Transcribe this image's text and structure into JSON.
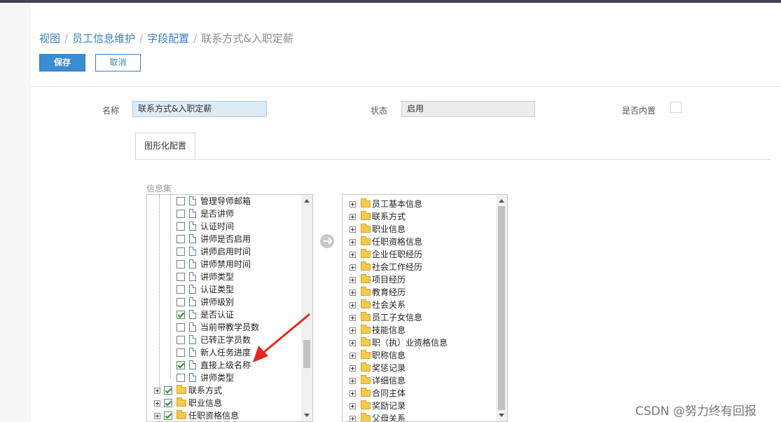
{
  "breadcrumb": [
    "视图",
    "员工信息维护",
    "字段配置",
    "联系方式&入职定薪"
  ],
  "toolbar": {
    "save_label": "保存",
    "cancel_label": "取消"
  },
  "form": {
    "name_label": "名称",
    "name_value": "联系方式&入职定薪",
    "status_label": "状态",
    "status_value": "启用",
    "builtin_label": "是否内置",
    "builtin_checked": false
  },
  "tab": {
    "label": "图形化配置"
  },
  "info_set_label": "信息集",
  "left_tree": {
    "child_items": [
      {
        "label": "管理导师邮箱",
        "checked": false
      },
      {
        "label": "是否讲师",
        "checked": false
      },
      {
        "label": "认证时间",
        "checked": false
      },
      {
        "label": "讲师是否启用",
        "checked": false
      },
      {
        "label": "讲师启用时间",
        "checked": false
      },
      {
        "label": "讲师禁用时间",
        "checked": false
      },
      {
        "label": "讲师类型",
        "checked": false
      },
      {
        "label": "认证类型",
        "checked": false
      },
      {
        "label": "讲师级别",
        "checked": false
      },
      {
        "label": "是否认证",
        "checked": true
      },
      {
        "label": "当前带教学员数",
        "checked": false
      },
      {
        "label": "已转正学员数",
        "checked": false
      },
      {
        "label": "新人任务进度",
        "checked": false
      },
      {
        "label": "直接上级名称",
        "checked": true
      },
      {
        "label": "讲师类型",
        "checked": false
      }
    ],
    "group_items": [
      {
        "label": "联系方式",
        "checked": true
      },
      {
        "label": "职业信息",
        "checked": true
      },
      {
        "label": "任职资格信息",
        "checked": true
      }
    ]
  },
  "right_tree": {
    "items": [
      "员工基本信息",
      "联系方式",
      "职业信息",
      "任职资格信息",
      "企业任职经历",
      "社会工作经历",
      "项目经历",
      "教育经历",
      "社会关系",
      "员工子女信息",
      "技能信息",
      "职（执）业资格信息",
      "职称信息",
      "奖惩记录",
      "详细信息",
      "合同主体",
      "奖励记录",
      "父母关系"
    ]
  },
  "watermark": "CSDN @努力终有回报",
  "colors": {
    "primary": "#3c8cd0",
    "link": "#3a7fc0",
    "annotation_arrow": "#e8281c"
  }
}
